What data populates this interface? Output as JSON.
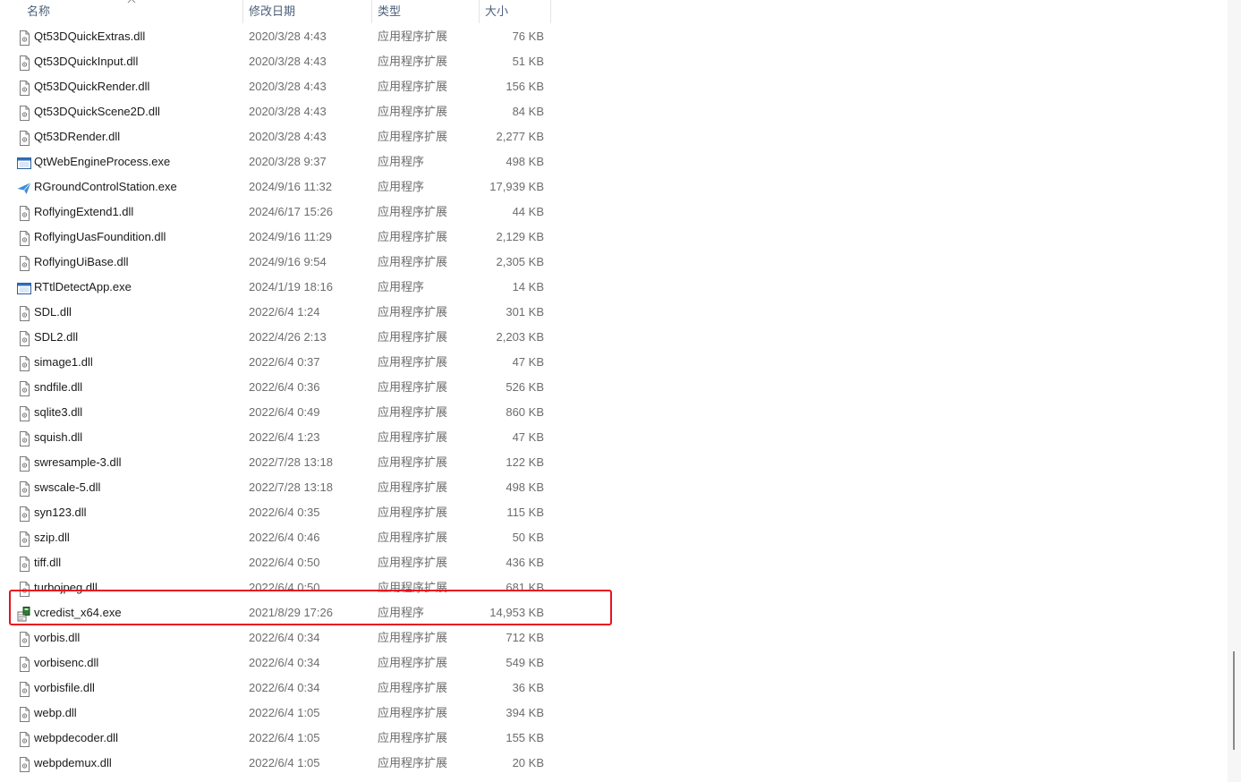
{
  "columns": {
    "name": "名称",
    "date": "修改日期",
    "type": "类型",
    "size": "大小"
  },
  "files": [
    {
      "name": "Qt53DQuickExtras.dll",
      "date": "2020/3/28 4:43",
      "type": "应用程序扩展",
      "size": "76 KB",
      "icon": "dll-file-icon"
    },
    {
      "name": "Qt53DQuickInput.dll",
      "date": "2020/3/28 4:43",
      "type": "应用程序扩展",
      "size": "51 KB",
      "icon": "dll-file-icon"
    },
    {
      "name": "Qt53DQuickRender.dll",
      "date": "2020/3/28 4:43",
      "type": "应用程序扩展",
      "size": "156 KB",
      "icon": "dll-file-icon"
    },
    {
      "name": "Qt53DQuickScene2D.dll",
      "date": "2020/3/28 4:43",
      "type": "应用程序扩展",
      "size": "84 KB",
      "icon": "dll-file-icon"
    },
    {
      "name": "Qt53DRender.dll",
      "date": "2020/3/28 4:43",
      "type": "应用程序扩展",
      "size": "2,277 KB",
      "icon": "dll-file-icon"
    },
    {
      "name": "QtWebEngineProcess.exe",
      "date": "2020/3/28 9:37",
      "type": "应用程序",
      "size": "498 KB",
      "icon": "app-window-icon"
    },
    {
      "name": "RGroundControlStation.exe",
      "date": "2024/9/16 11:32",
      "type": "应用程序",
      "size": "17,939 KB",
      "icon": "paper-plane-app-icon"
    },
    {
      "name": "RoflyingExtend1.dll",
      "date": "2024/6/17 15:26",
      "type": "应用程序扩展",
      "size": "44 KB",
      "icon": "dll-file-icon"
    },
    {
      "name": "RoflyingUasFoundition.dll",
      "date": "2024/9/16 11:29",
      "type": "应用程序扩展",
      "size": "2,129 KB",
      "icon": "dll-file-icon"
    },
    {
      "name": "RoflyingUiBase.dll",
      "date": "2024/9/16 9:54",
      "type": "应用程序扩展",
      "size": "2,305 KB",
      "icon": "dll-file-icon"
    },
    {
      "name": "RTtlDetectApp.exe",
      "date": "2024/1/19 18:16",
      "type": "应用程序",
      "size": "14 KB",
      "icon": "app-window-icon"
    },
    {
      "name": "SDL.dll",
      "date": "2022/6/4 1:24",
      "type": "应用程序扩展",
      "size": "301 KB",
      "icon": "dll-file-icon"
    },
    {
      "name": "SDL2.dll",
      "date": "2022/4/26 2:13",
      "type": "应用程序扩展",
      "size": "2,203 KB",
      "icon": "dll-file-icon"
    },
    {
      "name": "simage1.dll",
      "date": "2022/6/4 0:37",
      "type": "应用程序扩展",
      "size": "47 KB",
      "icon": "dll-file-icon"
    },
    {
      "name": "sndfile.dll",
      "date": "2022/6/4 0:36",
      "type": "应用程序扩展",
      "size": "526 KB",
      "icon": "dll-file-icon"
    },
    {
      "name": "sqlite3.dll",
      "date": "2022/6/4 0:49",
      "type": "应用程序扩展",
      "size": "860 KB",
      "icon": "dll-file-icon"
    },
    {
      "name": "squish.dll",
      "date": "2022/6/4 1:23",
      "type": "应用程序扩展",
      "size": "47 KB",
      "icon": "dll-file-icon"
    },
    {
      "name": "swresample-3.dll",
      "date": "2022/7/28 13:18",
      "type": "应用程序扩展",
      "size": "122 KB",
      "icon": "dll-file-icon"
    },
    {
      "name": "swscale-5.dll",
      "date": "2022/7/28 13:18",
      "type": "应用程序扩展",
      "size": "498 KB",
      "icon": "dll-file-icon"
    },
    {
      "name": "syn123.dll",
      "date": "2022/6/4 0:35",
      "type": "应用程序扩展",
      "size": "115 KB",
      "icon": "dll-file-icon"
    },
    {
      "name": "szip.dll",
      "date": "2022/6/4 0:46",
      "type": "应用程序扩展",
      "size": "50 KB",
      "icon": "dll-file-icon"
    },
    {
      "name": "tiff.dll",
      "date": "2022/6/4 0:50",
      "type": "应用程序扩展",
      "size": "436 KB",
      "icon": "dll-file-icon"
    },
    {
      "name": "turbojpeg.dll",
      "date": "2022/6/4 0:50",
      "type": "应用程序扩展",
      "size": "681 KB",
      "icon": "dll-file-icon"
    },
    {
      "name": "vcredist_x64.exe",
      "date": "2021/8/29 17:26",
      "type": "应用程序",
      "size": "14,953 KB",
      "icon": "installer-icon",
      "highlighted": true
    },
    {
      "name": "vorbis.dll",
      "date": "2022/6/4 0:34",
      "type": "应用程序扩展",
      "size": "712 KB",
      "icon": "dll-file-icon"
    },
    {
      "name": "vorbisenc.dll",
      "date": "2022/6/4 0:34",
      "type": "应用程序扩展",
      "size": "549 KB",
      "icon": "dll-file-icon"
    },
    {
      "name": "vorbisfile.dll",
      "date": "2022/6/4 0:34",
      "type": "应用程序扩展",
      "size": "36 KB",
      "icon": "dll-file-icon"
    },
    {
      "name": "webp.dll",
      "date": "2022/6/4 1:05",
      "type": "应用程序扩展",
      "size": "394 KB",
      "icon": "dll-file-icon"
    },
    {
      "name": "webpdecoder.dll",
      "date": "2022/6/4 1:05",
      "type": "应用程序扩展",
      "size": "155 KB",
      "icon": "dll-file-icon"
    },
    {
      "name": "webpdemux.dll",
      "date": "2022/6/4 1:05",
      "type": "应用程序扩展",
      "size": "20 KB",
      "icon": "dll-file-icon"
    }
  ],
  "colors": {
    "highlight_border": "#e81123",
    "header_text": "#4c607a",
    "secondary_text": "#6d6d6d"
  }
}
